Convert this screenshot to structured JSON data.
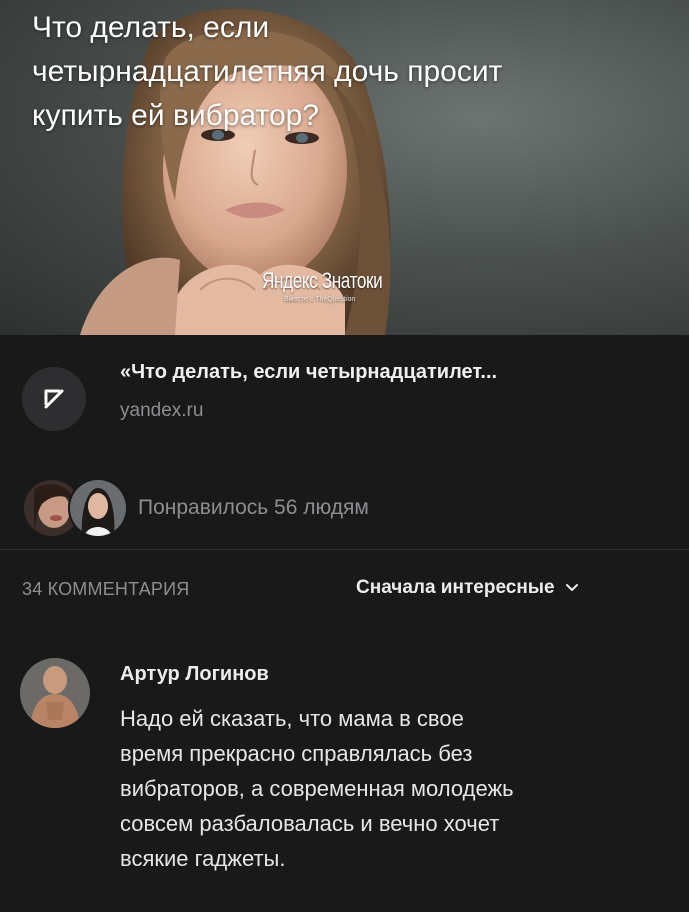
{
  "post": {
    "image_title": "Что делать, если\nчетырнадцатилетняя дочь просит\nкупить ей вибратор?",
    "brand": {
      "main": "Яндекс Знатоки",
      "sub": "Вместе с TheQuestion"
    }
  },
  "link_card": {
    "icon": "arrow-up-left-icon",
    "title": "«Что делать, если четырнадцатилет...",
    "domain": "yandex.ru"
  },
  "likes": {
    "text": "Понравилось 56 людям"
  },
  "comments": {
    "count_label": "34 КОММЕНТАРИЯ",
    "sort_label": "Сначала интересные",
    "sort_icon": "chevron-down-icon",
    "items": [
      {
        "author": "Артур Логинов",
        "text": "Надо ей сказать, что мама в свое\nвремя прекрасно справлялась без\nвибраторов, а современная молодежь\nсовсем разбаловалась и вечно хочет\nвсякие гаджеты."
      }
    ]
  },
  "colors": {
    "background": "#19191a",
    "primary_text": "#ececec",
    "secondary_text": "#8e8e92",
    "arrow_circle": "#2e2e30"
  }
}
